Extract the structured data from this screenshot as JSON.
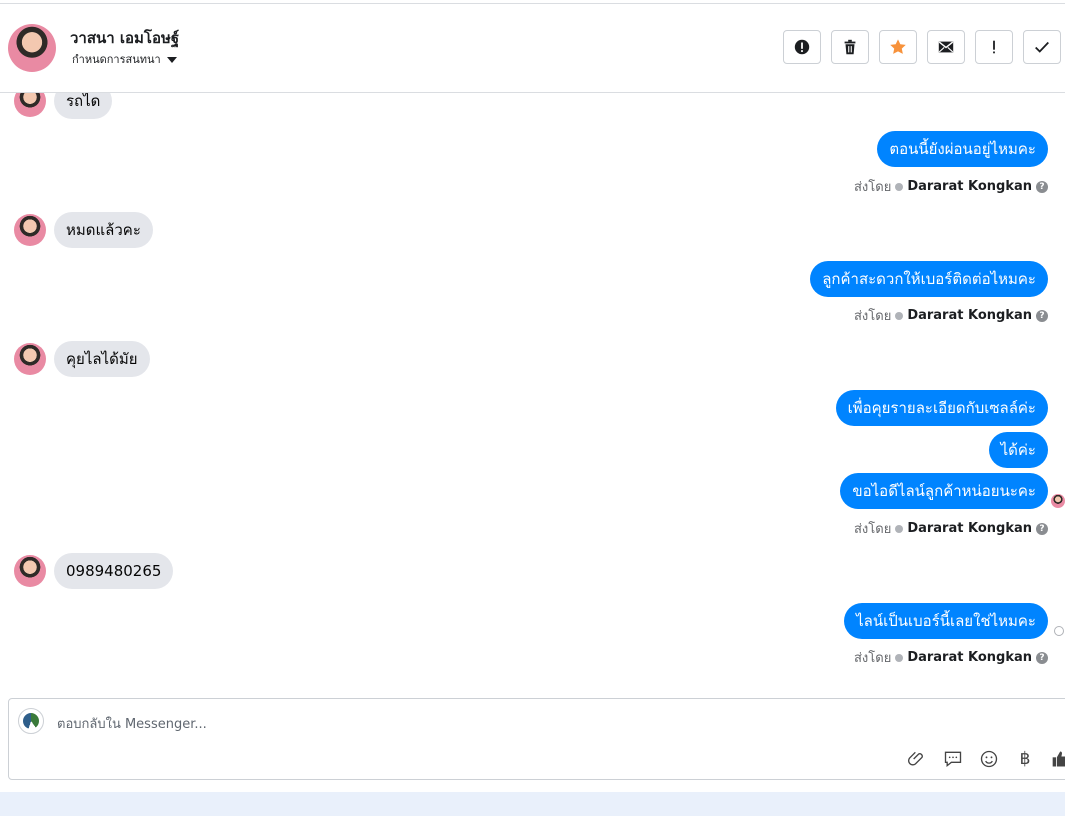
{
  "header": {
    "contact_name": "วาสนา เอมโอษฐ์",
    "assign_label": "กำหนดการสนทนา"
  },
  "toolbar": {
    "buttons": [
      "spam-icon",
      "trash-icon",
      "star-icon",
      "envelope-icon",
      "follow-up-icon",
      "done-icon"
    ]
  },
  "messages": {
    "in_0": "รถได",
    "out_1": "ตอนนี้ยังผ่อนอยู่ไหมคะ",
    "in_2": "หมดแล้วคะ",
    "out_3": "ลูกค้าสะดวกให้เบอร์ติดต่อไหมคะ",
    "in_4": "คุยไลได้มัย",
    "out_5": "เพื่อคุยรายละเอียดกับเซลล์ค่ะ",
    "out_6": "ได้ค่ะ",
    "out_7": "ขอไอดีไลน์ลูกค้าหน่อยนะคะ",
    "in_8": "0989480265",
    "out_9": "ไลน์เป็นเบอร์นี้เลยใช่ไหมคะ"
  },
  "sent_by": {
    "prefix": "ส่งโดย",
    "agent": "Dararat Kongkan",
    "help": "?"
  },
  "composer": {
    "placeholder": "ตอบกลับใน Messenger...",
    "currency": "฿"
  },
  "colors": {
    "outgoing_bubble": "#0084ff",
    "incoming_bubble": "#e4e6eb",
    "star": "#f7923b"
  }
}
